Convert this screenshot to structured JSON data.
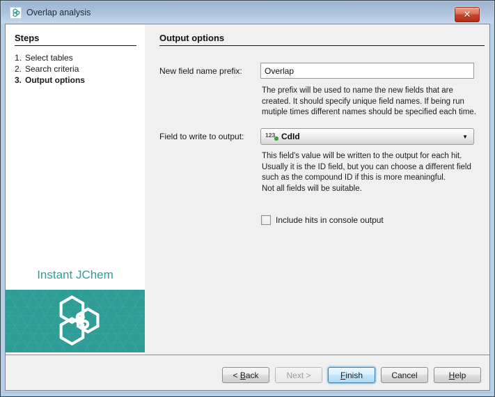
{
  "window": {
    "title": "Overlap analysis"
  },
  "icons": {
    "close": "✕",
    "dropdown_arrow": "▼"
  },
  "steps": {
    "heading": "Steps",
    "items": [
      {
        "num": "1.",
        "label": "Select tables",
        "active": false
      },
      {
        "num": "2.",
        "label": "Search criteria",
        "active": false
      },
      {
        "num": "3.",
        "label": "Output options",
        "active": true
      }
    ],
    "brand": "Instant JChem"
  },
  "main": {
    "heading": "Output options",
    "prefix_field": {
      "label": "New field name prefix:",
      "value": "Overlap",
      "help": "The prefix will be used to name the new fields that are\ncreated. It should specify unique field names. If being run\nmutiple times different names should be specified each time."
    },
    "output_field": {
      "label": "Field to write to output:",
      "icon_text": "123",
      "value": "CdId",
      "help": "This field's value will be written to the output for each hit.\nUsually it is the ID field, but you can choose a different field\nsuch as the compound ID if this is more meaningful.\nNot all fields will be suitable."
    },
    "console_checkbox": {
      "label": "Include hits in console output",
      "checked": false
    }
  },
  "buttons": [
    {
      "label": "< Back",
      "mnemonic": "B",
      "enabled": true
    },
    {
      "label": "Next >",
      "enabled": false
    },
    {
      "label": "Finish",
      "mnemonic": "F",
      "enabled": true,
      "default": true
    },
    {
      "label": "Cancel",
      "enabled": true
    },
    {
      "label": "Help",
      "mnemonic": "H",
      "enabled": true
    }
  ],
  "colors": {
    "accent_teal": "#2E9D96",
    "brand_text": "#27A09B",
    "default_button_border": "#3C7FB1",
    "close_button_red": "#C44732"
  }
}
